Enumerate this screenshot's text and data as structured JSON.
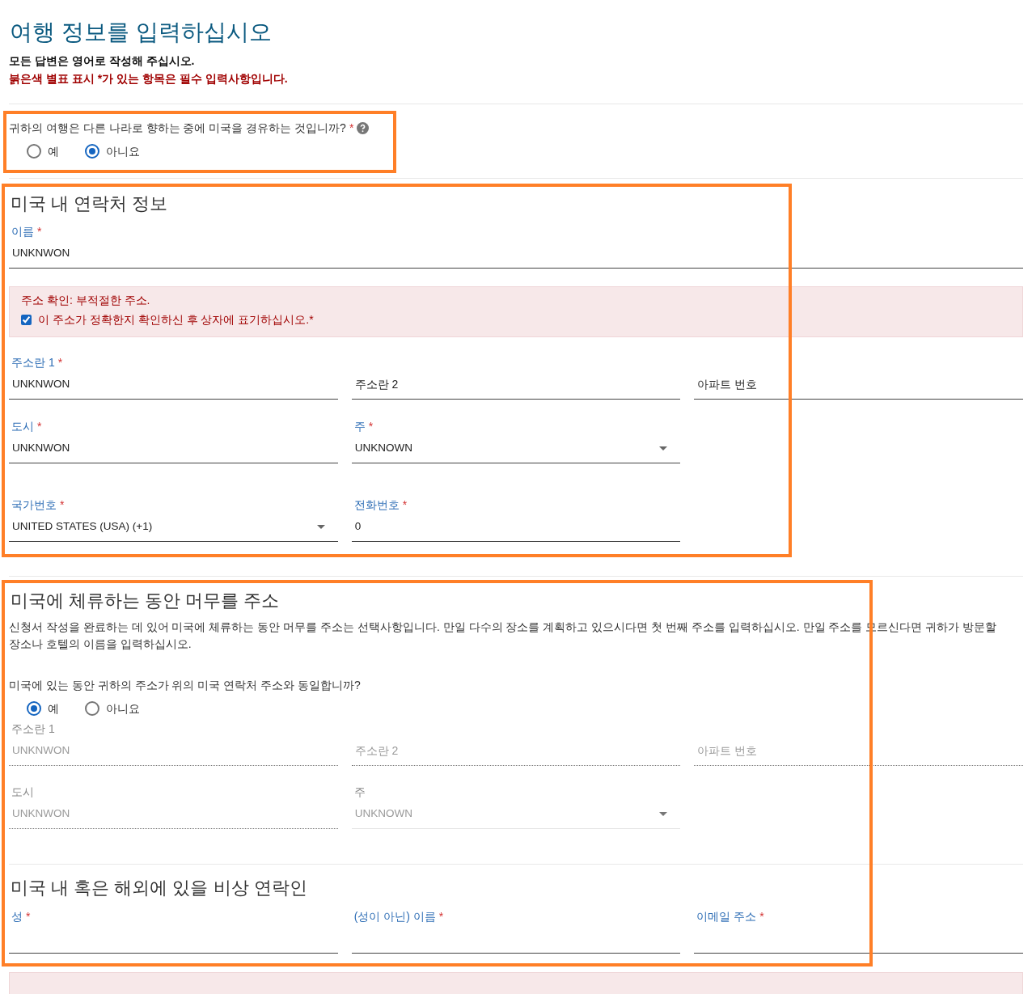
{
  "title": "여행 정보를 입력하십시오",
  "notes": [
    {
      "text": "모든 답변은 영어로 작성해 주십시오.",
      "kind": "plain"
    },
    {
      "text": "붉은색 별표 표시 *가 있는 항목은 필수 입력사항입니다.",
      "kind": "warning"
    }
  ],
  "transit_question": {
    "text": "귀하의 여행은 다른 나라로 향하는 중에 미국을 경유하는 것입니까?",
    "required_mark": "*",
    "options": [
      {
        "label": "예",
        "selected": false
      },
      {
        "label": "아니요",
        "selected": true
      }
    ]
  },
  "contact_section": {
    "heading": "미국 내 연락처 정보",
    "name_field": {
      "label": "이름",
      "required_mark": "*",
      "value": "UNKNWON",
      "kind": "text",
      "disabled": false
    },
    "alert": {
      "message": "주소 확인: 부적절한 주소.",
      "confirm_text": "이 주소가 정확한지 확인하신 후 상자에 표기하십시오.*",
      "checked": true
    },
    "rows": [
      [
        {
          "label": "주소란 1",
          "required_mark": "*",
          "value": "UNKNWON",
          "kind": "text",
          "disabled": false
        },
        {
          "placeholder": "주소란 2",
          "kind": "text",
          "disabled": false
        },
        {
          "placeholder": "아파트 번호",
          "kind": "text",
          "disabled": false
        }
      ],
      [
        {
          "label": "도시",
          "required_mark": "*",
          "value": "UNKNWON",
          "kind": "text",
          "disabled": false
        },
        {
          "label": "주",
          "required_mark": "*",
          "value": "UNKNOWN",
          "kind": "select",
          "disabled": false
        }
      ],
      [
        {
          "label": "국가번호",
          "required_mark": "*",
          "value": "UNITED STATES (USA) (+1)",
          "kind": "select",
          "disabled": false
        },
        {
          "label": "전화번호",
          "required_mark": "*",
          "value": "0",
          "kind": "text",
          "disabled": false
        }
      ]
    ]
  },
  "stay_section": {
    "heading": "미국에 체류하는 동안 머무를 주소",
    "description": "신청서 작성을 완료하는 데 있어 미국에 체류하는 동안 머무를 주소는 선택사항입니다. 만일 다수의 장소를 계획하고 있으시다면 첫 번째 주소를 입력하십시오. 만일 주소를 모르신다면 귀하가 방문할 장소나 호텔의 이름을 입력하십시오.",
    "question": "미국에 있는 동안 귀하의 주소가 위의 미국 연락처 주소와 동일합니까?",
    "options": [
      {
        "label": "예",
        "selected": true
      },
      {
        "label": "아니요",
        "selected": false
      }
    ],
    "rows": [
      [
        {
          "label": "주소란 1",
          "value": "UNKNWON",
          "kind": "text",
          "disabled": true
        },
        {
          "placeholder": "주소란 2",
          "kind": "text",
          "disabled": true
        },
        {
          "placeholder": "아파트 번호",
          "kind": "text",
          "disabled": true
        }
      ],
      [
        {
          "label": "도시",
          "value": "UNKNWON",
          "kind": "text",
          "disabled": true
        },
        {
          "label": "주",
          "value": "UNKNOWN",
          "kind": "select",
          "disabled": true
        }
      ]
    ]
  },
  "emergency_section": {
    "heading": "미국 내 혹은 해외에 있을 비상 연락인",
    "rows": [
      [
        {
          "label": "성",
          "required_mark": "*",
          "kind": "text",
          "disabled": false
        },
        {
          "label": "(성이 아닌) 이름",
          "required_mark": "*",
          "kind": "text",
          "disabled": false
        },
        {
          "label": "이메일 주소",
          "required_mark": "*",
          "kind": "text",
          "disabled": false
        }
      ]
    ]
  }
}
